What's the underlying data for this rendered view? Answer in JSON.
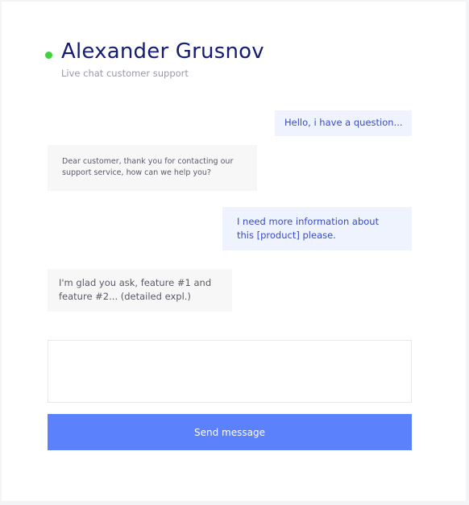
{
  "header": {
    "agent_name": "Alexander Grusnov",
    "subtitle": "Live chat customer support",
    "status": "online",
    "status_color": "#3ed43a"
  },
  "messages": [
    {
      "from": "user",
      "text": "Hello, i have a question..."
    },
    {
      "from": "support",
      "text": "Dear customer, thank you for contacting our support service, how can we help you?"
    },
    {
      "from": "user",
      "text": "I need more information about this [product] please."
    },
    {
      "from": "support",
      "text": "I'm glad you ask, feature #1 and feature #2... (detailed expl.)"
    }
  ],
  "composer": {
    "value": "",
    "placeholder": "",
    "send_label": "Send message"
  },
  "colors": {
    "accent": "#5b81fd",
    "name": "#151c74",
    "user_bubble_bg": "#eef3fe",
    "user_bubble_text": "#3a4bc9",
    "support_bubble_bg": "#f7f7f8"
  }
}
